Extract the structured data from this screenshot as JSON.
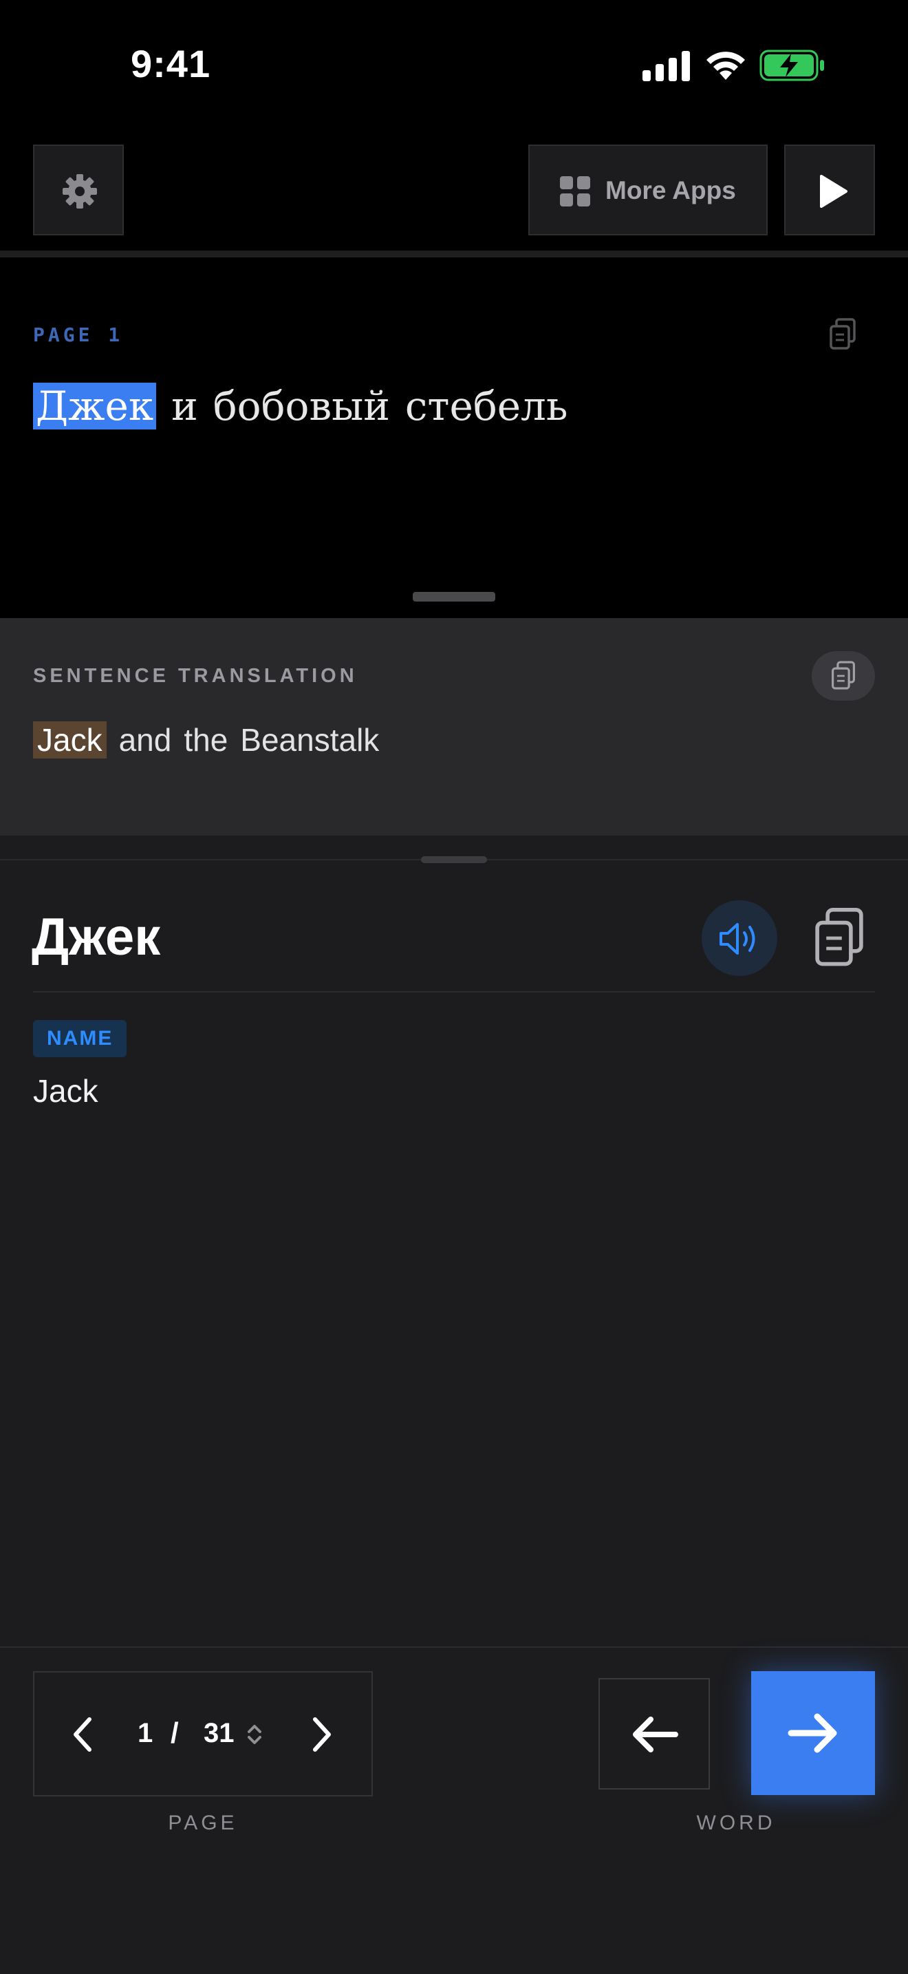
{
  "status_bar": {
    "time": "9:41"
  },
  "toolbar": {
    "more_apps_label": "More Apps"
  },
  "reader": {
    "page_label": "PAGE 1",
    "words": [
      "Джек",
      "и",
      "бобовый",
      "стебель"
    ]
  },
  "translation": {
    "label": "SENTENCE TRANSLATION",
    "words": [
      "Jack",
      "and",
      "the",
      "Beanstalk"
    ]
  },
  "word_detail": {
    "word": "Джек",
    "part_of_speech": "NAME",
    "meaning": "Jack"
  },
  "navigation": {
    "current_page": "1",
    "separator": "/",
    "total_pages": "31",
    "page_caption": "PAGE",
    "word_caption": "WORD"
  },
  "colors": {
    "accent": "#3b7ef2",
    "translation_highlight": "#5b4530",
    "badge_text": "#2f8cff",
    "battery_charging": "#34c759"
  }
}
